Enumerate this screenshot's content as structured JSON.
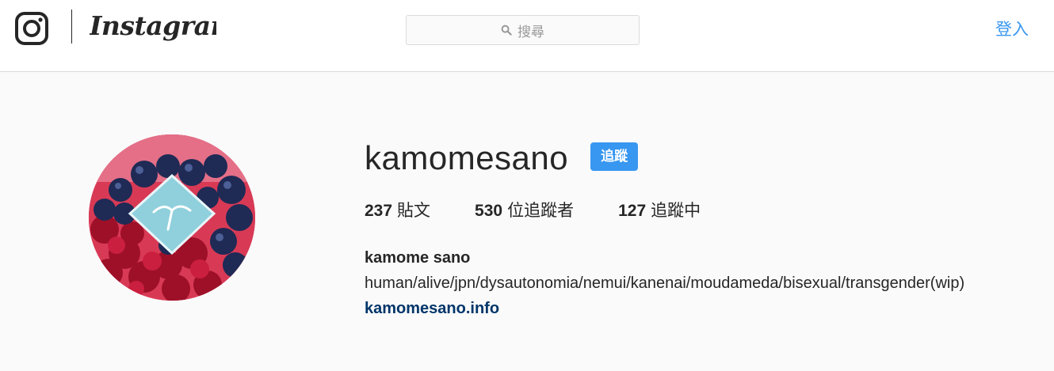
{
  "header": {
    "logo_word": "Instagram",
    "search_placeholder": "搜尋",
    "login_label": "登入"
  },
  "profile": {
    "username": "kamomesano",
    "follow_label": "追蹤",
    "stats": [
      {
        "count": "237",
        "label": "貼文"
      },
      {
        "count": "530",
        "label": "位追蹤者"
      },
      {
        "count": "127",
        "label": "追蹤中"
      }
    ],
    "full_name": "kamome sano",
    "bio": "human/alive/jpn/dysautonomia/nemui/kanenai/moudameda/bisexual/transgender(wip)",
    "website": "kamomesano.info"
  },
  "icons": {
    "logo": "instagram-glyph-icon",
    "search": "search-icon"
  },
  "colors": {
    "accent": "#3897f0",
    "link": "#003569",
    "text": "#262626",
    "background": "#fafafa",
    "border": "#dbdbdb"
  }
}
